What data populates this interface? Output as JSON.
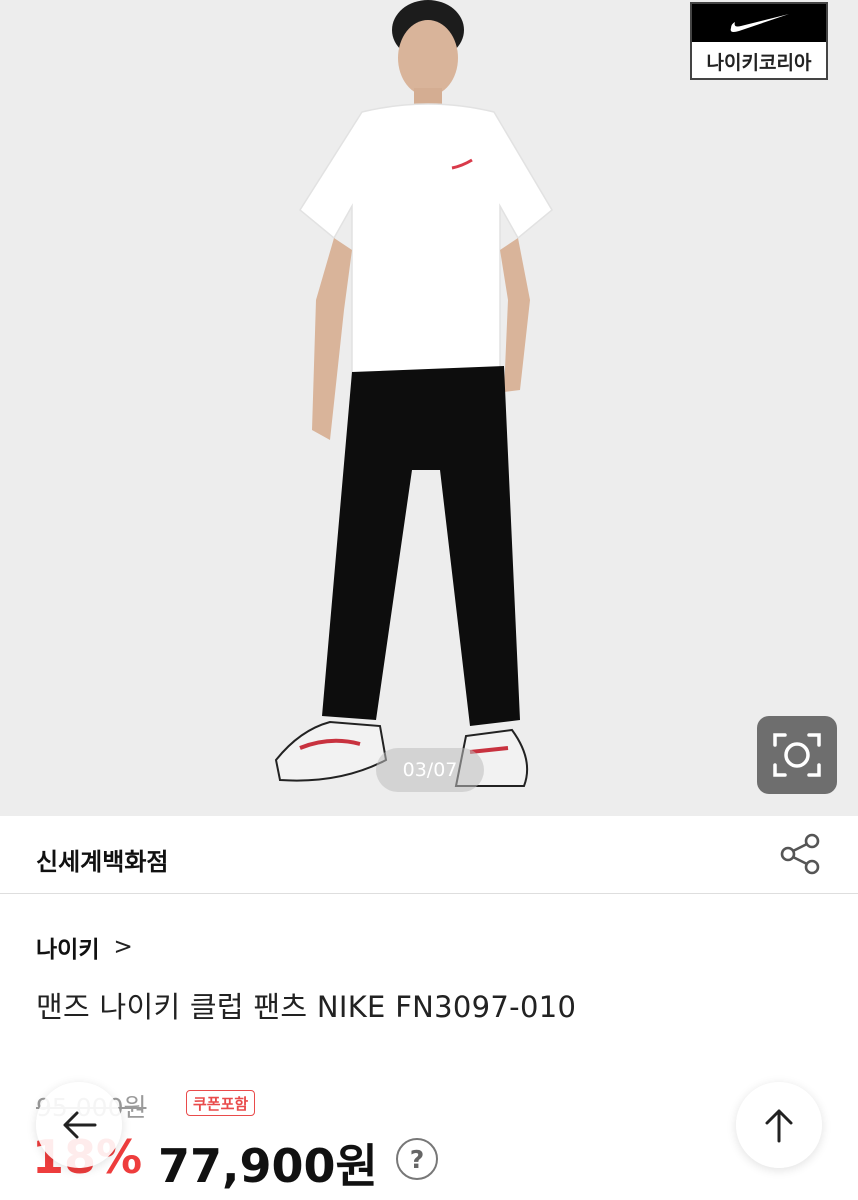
{
  "hero": {
    "brand_badge_text": "나이키코리아",
    "pager": "03/07"
  },
  "icons": {
    "brand_logo": "nike-swoosh-icon",
    "lens": "camera-lens-icon",
    "share": "share-icon",
    "back": "arrow-left-icon",
    "top": "arrow-up-icon",
    "help": "question-icon"
  },
  "seller": {
    "name": "신세계백화점"
  },
  "product": {
    "brand": "나이키",
    "brand_chevron": ">",
    "title": "맨즈 나이키 클럽 팬츠 NIKE FN3097-010"
  },
  "price": {
    "original": "95,000원",
    "coupon_badge": "쿠폰포함",
    "discount": "18%",
    "sale": "77,900원",
    "help_glyph": "?"
  },
  "colors": {
    "accent_red": "#ee3d3d",
    "coupon_red": "#e94b4b",
    "hero_bg": "#ededed"
  }
}
